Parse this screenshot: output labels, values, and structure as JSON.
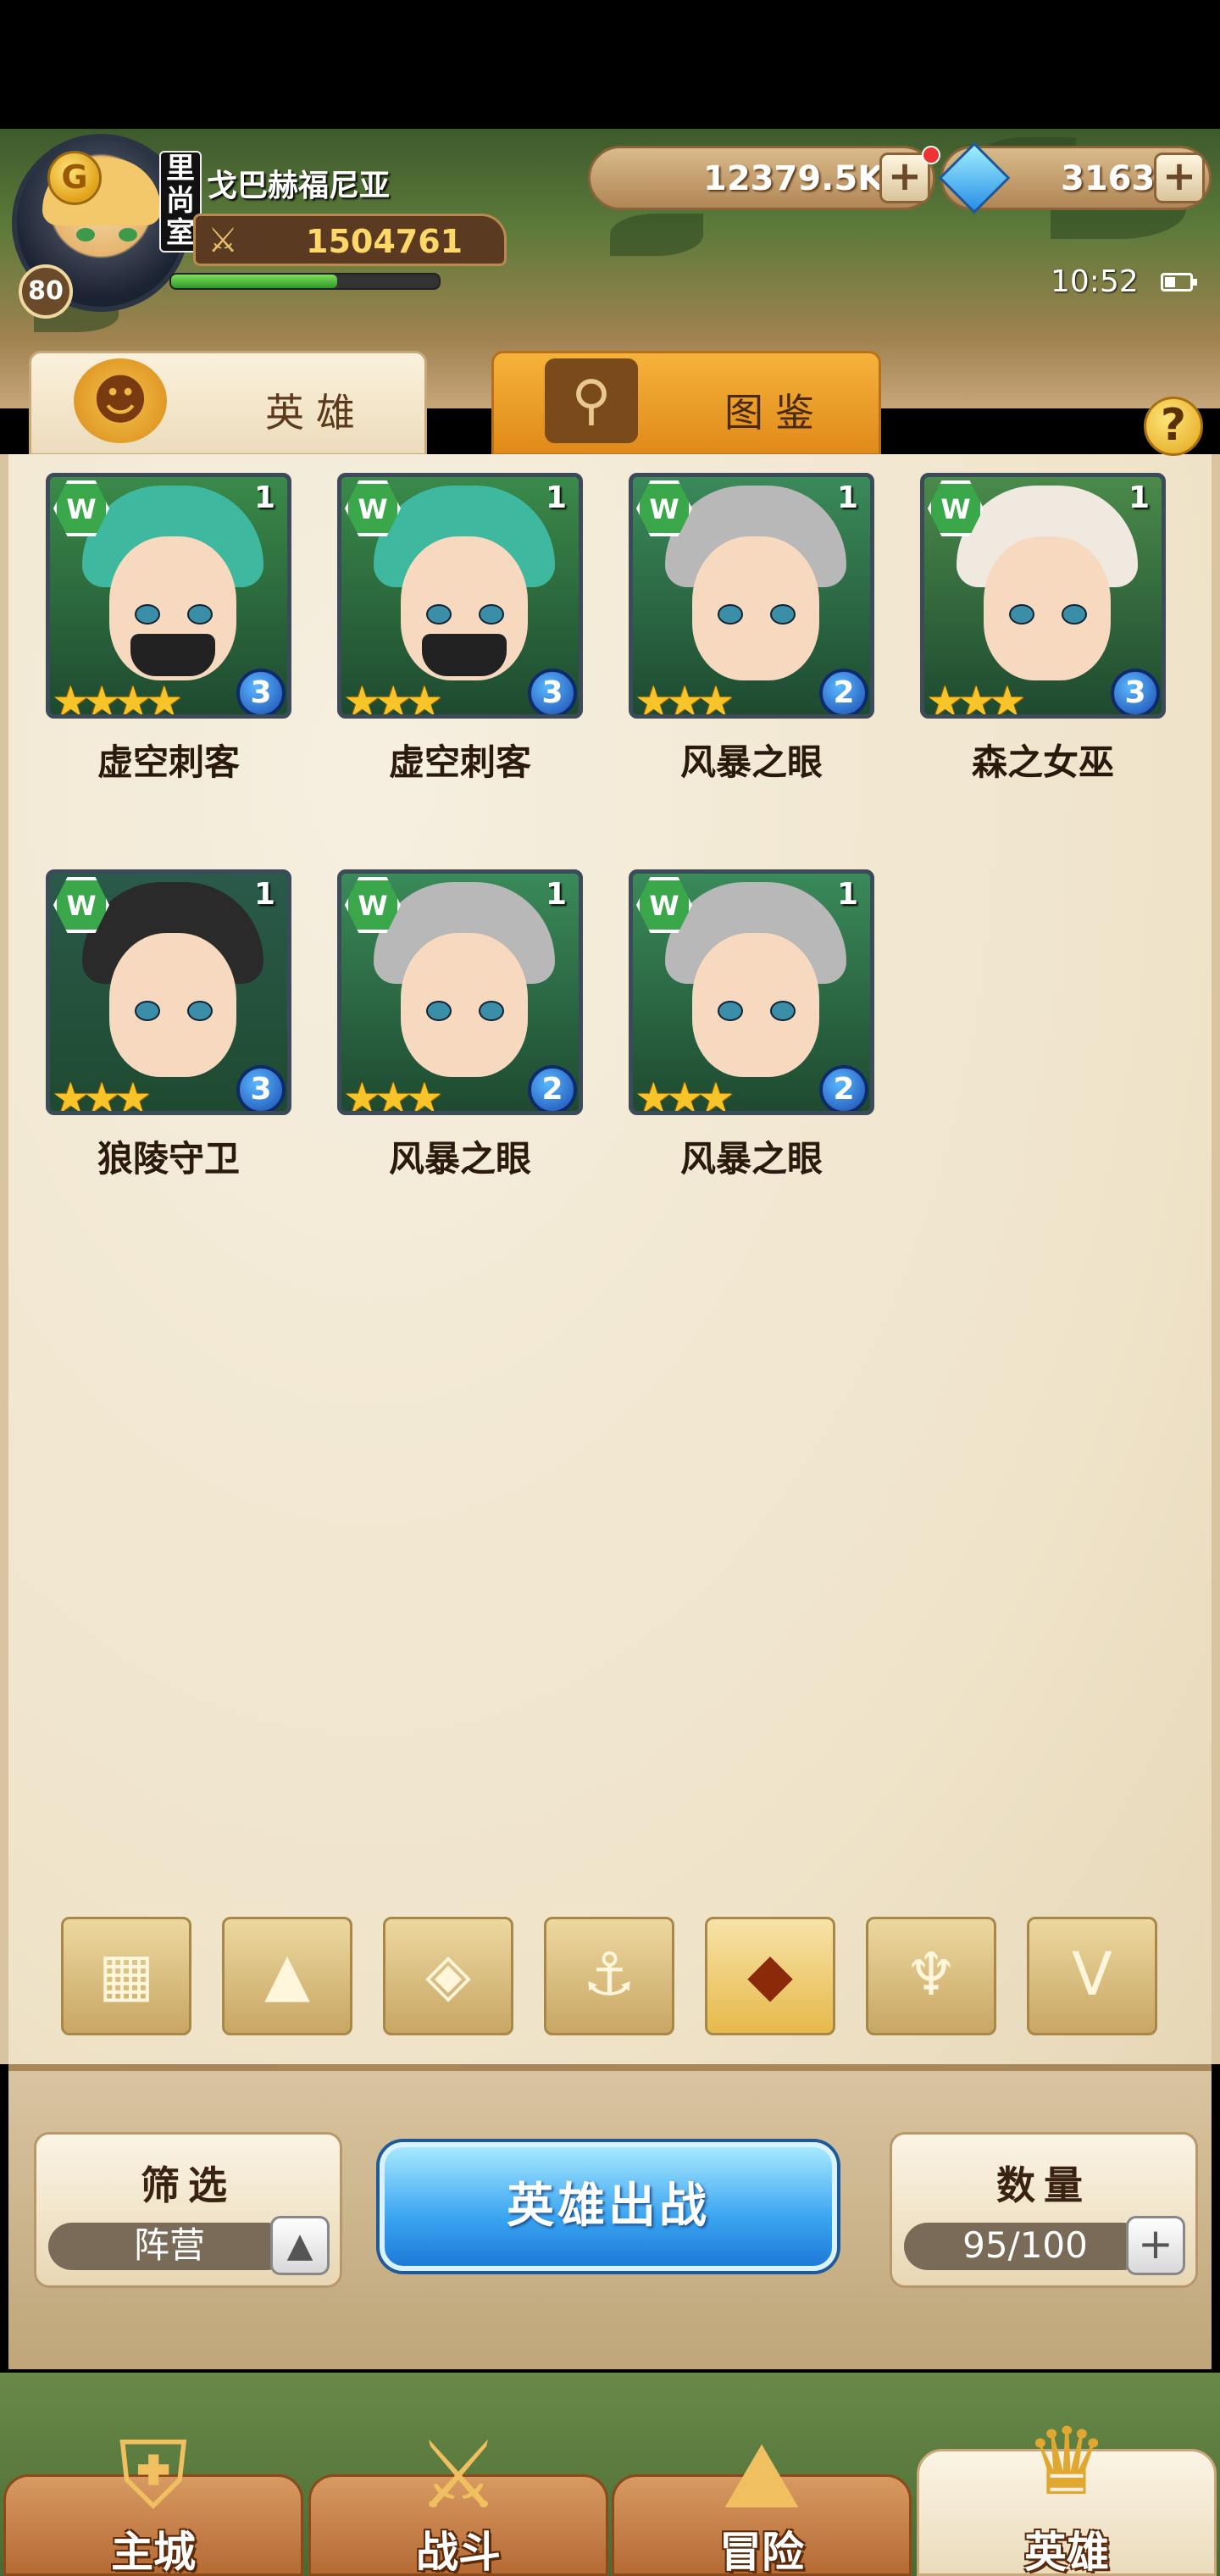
{
  "player": {
    "name": "戈巴赫福尼亚",
    "level": "80",
    "power": "1504761",
    "exp_fraction": 0.62,
    "badge_text": "里尚室"
  },
  "currency": {
    "gold": "12379.5K",
    "gems": "3163",
    "plus": "+"
  },
  "status": {
    "time": "10:52"
  },
  "tabs": {
    "heroes": "英雄",
    "codex": "图鉴",
    "help": "?"
  },
  "heroes": [
    {
      "name": "虚空刺客",
      "stars": "★★★★",
      "grade": "3",
      "count": "1",
      "hair": "#3fb8a0",
      "bg": "#3a8a4a",
      "mask": true
    },
    {
      "name": "虚空刺客",
      "stars": "★★★",
      "grade": "3",
      "count": "1",
      "hair": "#3fb8a0",
      "bg": "#3a8a4a",
      "mask": true
    },
    {
      "name": "风暴之眼",
      "stars": "★★★",
      "grade": "2",
      "count": "1",
      "hair": "#b8b8b8",
      "bg": "#3a8a5a",
      "mask": false
    },
    {
      "name": "森之女巫",
      "stars": "★★★",
      "grade": "3",
      "count": "1",
      "hair": "#efe9df",
      "bg": "#4a8a4a",
      "mask": false
    },
    {
      "name": "狼陵守卫",
      "stars": "★★★",
      "grade": "3",
      "count": "1",
      "hair": "#2a2a2a",
      "bg": "#2a5a4a",
      "mask": false
    },
    {
      "name": "风暴之眼",
      "stars": "★★★",
      "grade": "2",
      "count": "1",
      "hair": "#b8b8b8",
      "bg": "#3a8a5a",
      "mask": false
    },
    {
      "name": "风暴之眼",
      "stars": "★★★",
      "grade": "2",
      "count": "1",
      "hair": "#b8b8b8",
      "bg": "#3a8a5a",
      "mask": false
    }
  ],
  "faction_filters": [
    {
      "icon": "grid-icon",
      "glyph": "▦",
      "active": false
    },
    {
      "icon": "mountain-icon",
      "glyph": "▲",
      "active": false
    },
    {
      "icon": "diamond-icon",
      "glyph": "◈",
      "active": false
    },
    {
      "icon": "anchor-icon",
      "glyph": "⚓",
      "active": false
    },
    {
      "icon": "beast-icon",
      "glyph": "◆",
      "active": true
    },
    {
      "icon": "horns-icon",
      "glyph": "♆",
      "active": false
    },
    {
      "icon": "wings-icon",
      "glyph": "V",
      "active": false
    }
  ],
  "bottom": {
    "filter_title": "筛选",
    "filter_value": "阵营",
    "deploy_label": "英雄出战",
    "count_title": "数量",
    "count_value": "95/100"
  },
  "nav": [
    {
      "label": "主城",
      "icon": "castle-icon",
      "glyph": "⛨",
      "active": false
    },
    {
      "label": "战斗",
      "icon": "swords-icon",
      "glyph": "⚔",
      "active": false
    },
    {
      "label": "冒险",
      "icon": "map-icon",
      "glyph": "⛰",
      "active": false
    },
    {
      "label": "英雄",
      "icon": "hero-helmet-icon",
      "glyph": "♛",
      "active": true
    }
  ],
  "colors": {
    "accent_blue": "#39a4f0",
    "gold": "#ffd86a",
    "faction_green": "#3aa84a"
  }
}
